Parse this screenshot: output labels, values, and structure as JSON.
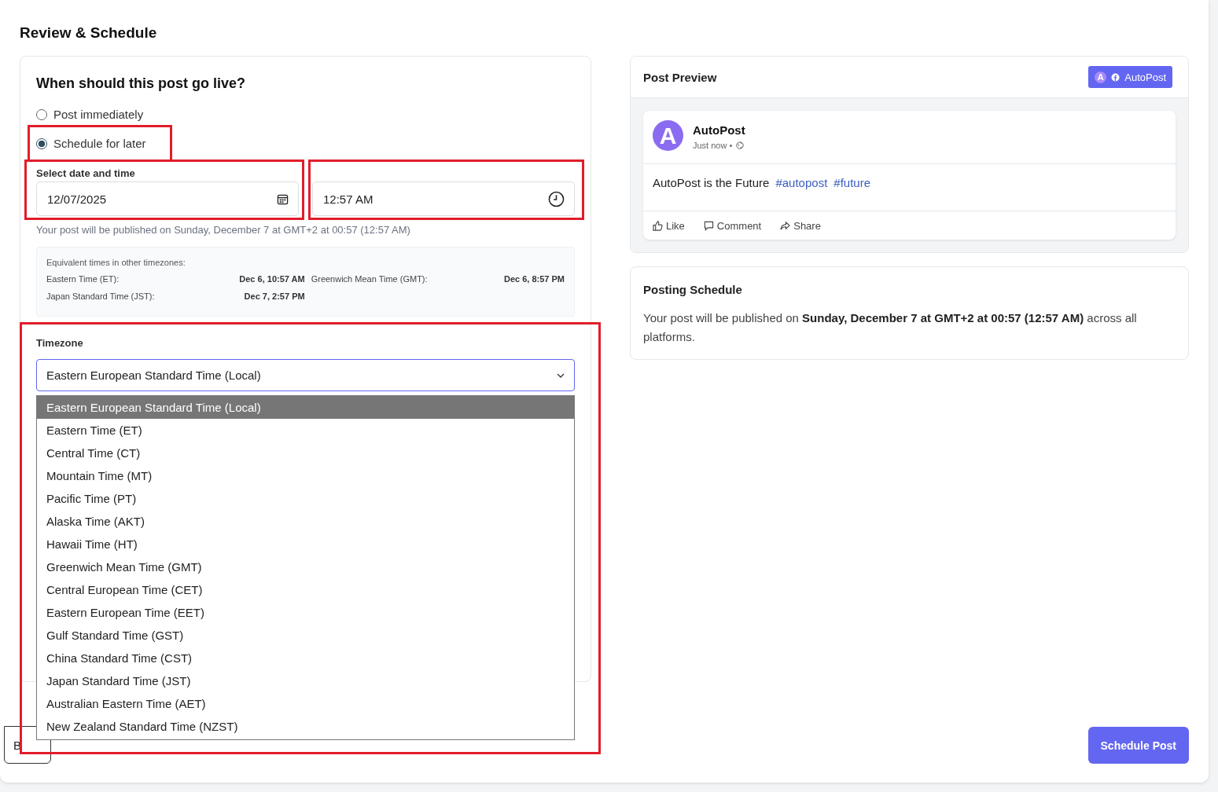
{
  "page": {
    "title": "Review & Schedule"
  },
  "schedule_form": {
    "question": "When should this post go live?",
    "options": [
      {
        "label": "Post immediately",
        "selected": false
      },
      {
        "label": "Schedule for later",
        "selected": true
      }
    ],
    "datetime_label": "Select date and time",
    "date_value": "12/07/2025",
    "time_value": "12:57 AM",
    "publish_note": "Your post will be published on Sunday, December 7 at GMT+2 at 00:57 (12:57 AM)",
    "equivalents": {
      "title": "Equivalent times in other timezones:",
      "items": [
        {
          "zone": "Eastern Time (ET):",
          "time": "Dec 6, 10:57 AM"
        },
        {
          "zone": "Greenwich Mean Time (GMT):",
          "time": "Dec 6, 8:57 PM"
        },
        {
          "zone": "Japan Standard Time (JST):",
          "time": "Dec 7, 2:57 PM"
        }
      ]
    },
    "timezone_label": "Timezone",
    "timezone_value": "Eastern European Standard Time (Local)",
    "timezone_options": [
      {
        "label": "Eastern European Standard Time (Local)",
        "selected": true
      },
      {
        "label": "Eastern Time (ET)",
        "selected": false
      },
      {
        "label": "Central Time (CT)",
        "selected": false
      },
      {
        "label": "Mountain Time (MT)",
        "selected": false
      },
      {
        "label": "Pacific Time (PT)",
        "selected": false
      },
      {
        "label": "Alaska Time (AKT)",
        "selected": false
      },
      {
        "label": "Hawaii Time (HT)",
        "selected": false
      },
      {
        "label": "Greenwich Mean Time (GMT)",
        "selected": false
      },
      {
        "label": "Central European Time (CET)",
        "selected": false
      },
      {
        "label": "Eastern European Time (EET)",
        "selected": false
      },
      {
        "label": "Gulf Standard Time (GST)",
        "selected": false
      },
      {
        "label": "China Standard Time (CST)",
        "selected": false
      },
      {
        "label": "Japan Standard Time (JST)",
        "selected": false
      },
      {
        "label": "Australian Eastern Time (AET)",
        "selected": false
      },
      {
        "label": "New Zealand Standard Time (NZST)",
        "selected": false
      }
    ]
  },
  "footer_left_button": "B",
  "post_preview": {
    "title": "Post Preview",
    "badge_logo_letter": "A",
    "platform_badge": "AutoPost",
    "avatar_letter": "A",
    "account": "AutoPost",
    "time": "Just now •",
    "text": "AutoPost is the Future",
    "hashtags": [
      "#autopost",
      "#future"
    ],
    "actions": [
      "Like",
      "Comment",
      "Share"
    ]
  },
  "posting_schedule": {
    "title": "Posting Schedule",
    "text": "Your post will be published on **Sunday, December 7 at GMT+2 at 00:57 (12:57 AM)** across all platforms."
  },
  "schedule_button": "Schedule Post"
}
